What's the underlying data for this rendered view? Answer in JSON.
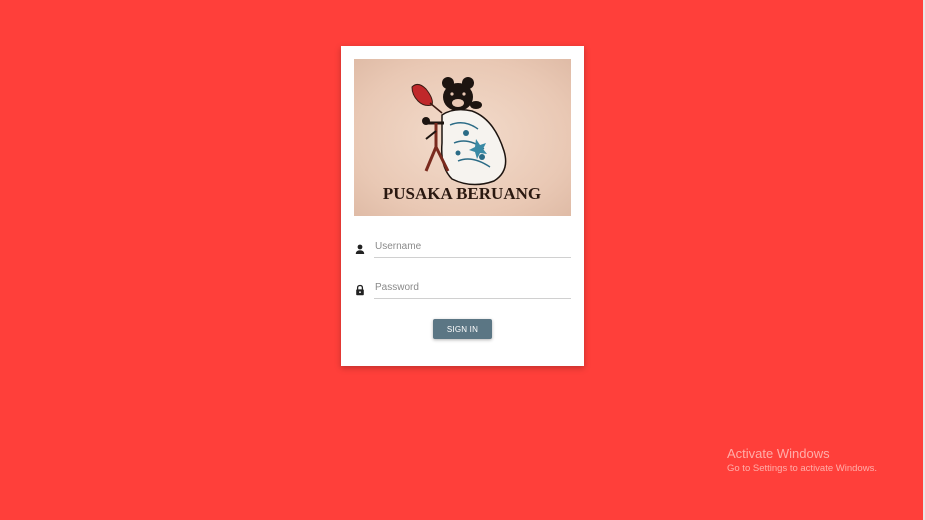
{
  "page": {
    "background_color": "#ff3f3a"
  },
  "login": {
    "logo": {
      "brand_text": "PUSAKA BERUANG",
      "icon": "bear-batik-logo-icon"
    },
    "username": {
      "placeholder": "Username",
      "value": "",
      "icon": "person-icon"
    },
    "password": {
      "placeholder": "Password",
      "value": "",
      "icon": "lock-icon"
    },
    "signin_label": "SIGN IN",
    "button_color": "#5b7684"
  },
  "watermark": {
    "title": "Activate Windows",
    "subtitle": "Go to Settings to activate Windows."
  }
}
